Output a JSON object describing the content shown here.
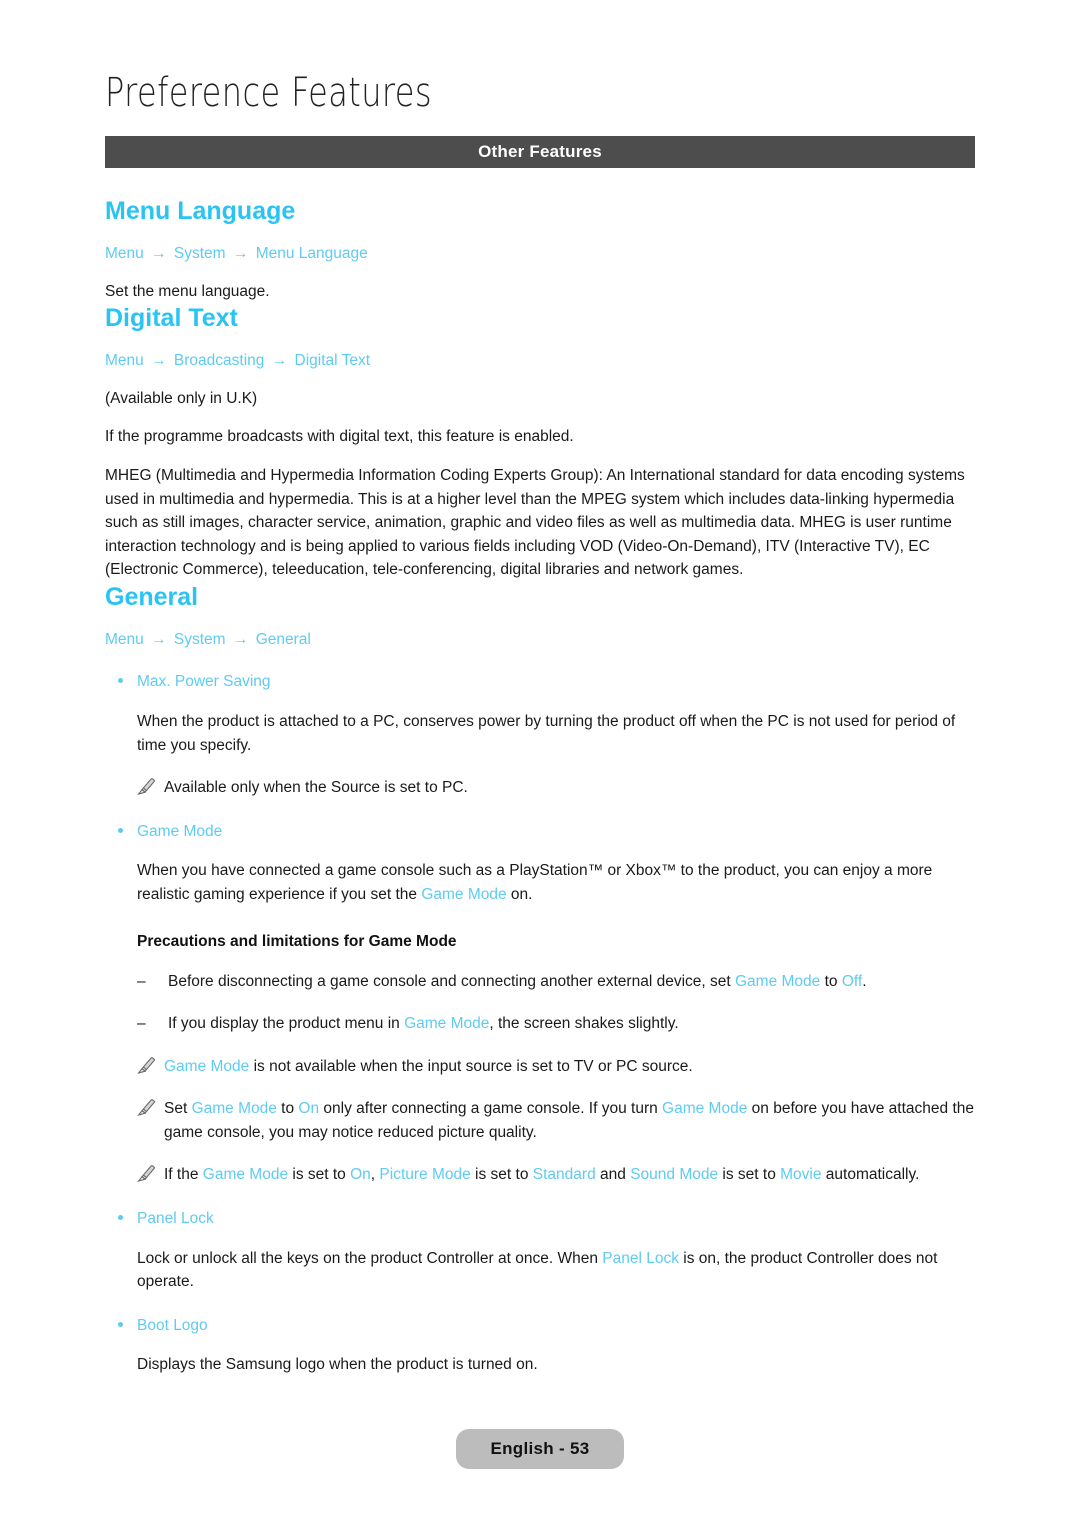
{
  "document": {
    "chapter_title": "Preference Features",
    "section_bar_label": "Other Features"
  },
  "sections": {
    "menu_language": {
      "heading": "Menu Language",
      "breadcrumb": [
        "Menu",
        "System",
        "Menu Language"
      ],
      "arrow": "→",
      "body": "Set the menu language."
    },
    "digital_text": {
      "heading": "Digital Text",
      "breadcrumb": [
        "Menu",
        "Broadcasting",
        "Digital Text"
      ],
      "availability": "(Available only in U.K)",
      "body": "If the programme broadcasts with digital text, this feature is enabled.",
      "mheg_paragraph": "MHEG (Multimedia and Hypermedia Information Coding Experts Group): An International standard for data encoding systems used in multimedia and hypermedia. This is at a higher level than the MPEG system which includes data-linking hypermedia such as still images, character service, animation, graphic and video files as well as multimedia data. MHEG is user runtime interaction technology and is being applied to various fields including VOD (Video-On-Demand), ITV (Interactive TV), EC (Electronic Commerce), teleeducation, tele-conferencing, digital libraries and network games."
    },
    "general": {
      "heading": "General",
      "breadcrumb": [
        "Menu",
        "System",
        "General"
      ],
      "max_power_saving": {
        "label": "Max. Power Saving",
        "body": "When the product is attached to a PC, conserves power by turning the product off when the PC is not used for period of time you specify.",
        "note": "Available only when the Source is set to PC."
      },
      "game_mode": {
        "label": "Game Mode",
        "body_1": "When you have connected a game console such as a PlayStation™ or Xbox™ to the product, you can enjoy a more realistic gaming experience if you set the ",
        "body_1_link": "Game Mode",
        "body_1_end": " on.",
        "precautions_heading": "Precautions and limitations for Game Mode",
        "dash_1": {
          "part_1": "Before disconnecting a game console and connecting another external device, set ",
          "link_1": "Game Mode",
          "part_2": " to ",
          "link_2": "Off",
          "part_3": "."
        },
        "dash_2": {
          "part_1": "If you display the product menu in ",
          "link_1": "Game Mode",
          "part_2": ", the screen shakes slightly."
        },
        "note_1": {
          "link_1": "Game Mode",
          "part_1": " is not available when the input source is set to TV or PC source."
        },
        "note_2": {
          "part_0": "Set ",
          "link_1": "Game Mode",
          "part_1": " to ",
          "link_2": "On",
          "part_2": " only after connecting a game console. If you turn ",
          "link_3": "Game Mode",
          "part_3": " on before you have attached the game console, you may notice reduced picture quality."
        },
        "note_3": {
          "part_0": "If the ",
          "link_1": "Game Mode",
          "part_1": " is set to ",
          "link_2": "On",
          "part_2": ", ",
          "link_3": "Picture Mode",
          "part_3": " is set to ",
          "link_4": "Standard",
          "part_4": " and ",
          "link_5": "Sound Mode",
          "part_5": " is set to ",
          "link_6": "Movie",
          "part_6": " automatically."
        }
      },
      "panel_lock": {
        "label": "Panel Lock",
        "body_1": "Lock or unlock all the keys on the product Controller at once. When ",
        "body_1_link": "Panel Lock",
        "body_1_end": " is on, the product Controller does not operate."
      },
      "boot_logo": {
        "label": "Boot Logo",
        "body": "Displays the Samsung logo when the product is turned on."
      }
    }
  },
  "footer": {
    "page_label": "English - 53"
  },
  "colors": {
    "accent_cyan": "#5ecbf2",
    "heading_cyan": "#2ac4f4",
    "section_bar": "#4d4d4d",
    "pill_gray": "#bcbcbc"
  },
  "icons": {
    "note": "pencil-icon",
    "bullet": "bullet-dot",
    "dash": "–",
    "arrow": "→"
  }
}
